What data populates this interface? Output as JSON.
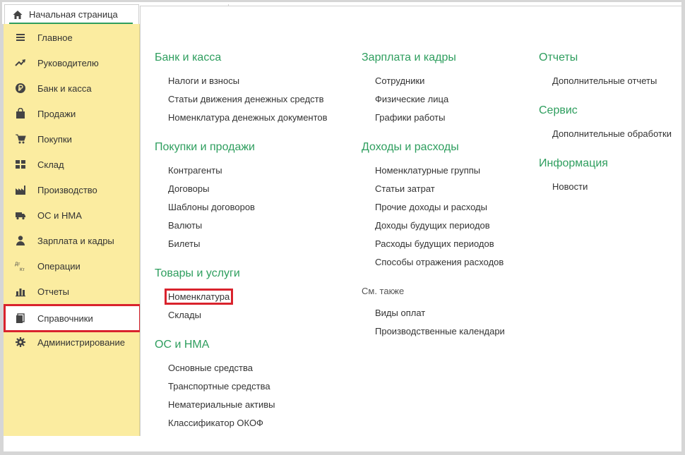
{
  "tabs": {
    "home_label": "Начальная страница"
  },
  "sidebar": {
    "items": [
      {
        "label": "Главное",
        "icon": "menu-icon"
      },
      {
        "label": "Руководителю",
        "icon": "trend-up-icon"
      },
      {
        "label": "Банк и касса",
        "icon": "ruble-icon"
      },
      {
        "label": "Продажи",
        "icon": "shopping-bag-icon"
      },
      {
        "label": "Покупки",
        "icon": "cart-icon"
      },
      {
        "label": "Склад",
        "icon": "warehouse-icon"
      },
      {
        "label": "Производство",
        "icon": "factory-icon"
      },
      {
        "label": "ОС и НМА",
        "icon": "truck-icon"
      },
      {
        "label": "Зарплата и кадры",
        "icon": "person-icon"
      },
      {
        "label": "Операции",
        "icon": "debit-credit-icon"
      },
      {
        "label": "Отчеты",
        "icon": "bar-chart-icon"
      },
      {
        "label": "Справочники",
        "icon": "books-icon",
        "active": true
      },
      {
        "label": "Администрирование",
        "icon": "gear-icon"
      }
    ],
    "dt_kt": [
      "Дт",
      "Кт"
    ]
  },
  "sections": {
    "bank": {
      "title": "Банк и касса",
      "links": [
        "Налоги и взносы",
        "Статьи движения денежных средств",
        "Номенклатура денежных документов"
      ]
    },
    "purchases": {
      "title": "Покупки и продажи",
      "links": [
        "Контрагенты",
        "Договоры",
        "Шаблоны договоров",
        "Валюты",
        "Билеты"
      ]
    },
    "goods": {
      "title": "Товары и услуги",
      "links": [
        "Номенклатура",
        "Склады"
      ]
    },
    "assets": {
      "title": "ОС и НМА",
      "links": [
        "Основные средства",
        "Транспортные средства",
        "Нематериальные активы",
        "Классификатор ОКОФ"
      ]
    },
    "salary": {
      "title": "Зарплата и кадры",
      "links": [
        "Сотрудники",
        "Физические лица",
        "Графики работы"
      ]
    },
    "income": {
      "title": "Доходы и расходы",
      "links": [
        "Номенклатурные группы",
        "Статьи затрат",
        "Прочие доходы и расходы",
        "Доходы будущих периодов",
        "Расходы будущих периодов",
        "Способы отражения расходов"
      ]
    },
    "see_also": {
      "title": "См. также",
      "links": [
        "Виды оплат",
        "Производственные календари"
      ]
    },
    "reports": {
      "title": "Отчеты",
      "links": [
        "Дополнительные отчеты"
      ]
    },
    "service": {
      "title": "Сервис",
      "links": [
        "Дополнительные обработки"
      ]
    },
    "info": {
      "title": "Информация",
      "links": [
        "Новости"
      ]
    }
  },
  "colors": {
    "sidebar_bg": "#fbeca0",
    "section_title": "#2e9e5e",
    "highlight": "#d9232d"
  }
}
